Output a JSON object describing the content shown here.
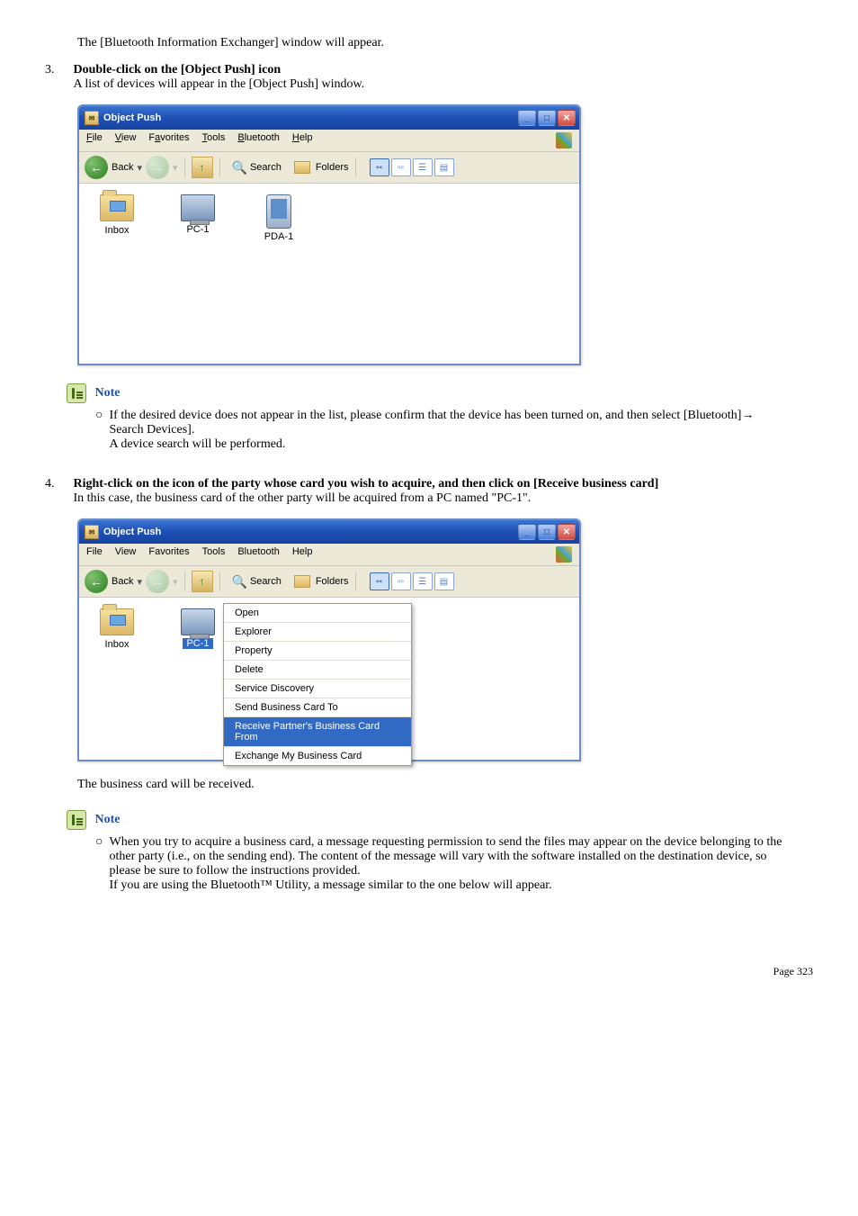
{
  "intro_text": "The [Bluetooth Information Exchanger] window will appear.",
  "step3": {
    "num": "3.",
    "title": "Double-click on the [Object Push] icon",
    "sub": "A list of devices will appear in the [Object Push] window."
  },
  "win1": {
    "title": "Object Push",
    "menus": {
      "file": "File",
      "view": "View",
      "favorites": "Favorites",
      "tools": "Tools",
      "bluetooth": "Bluetooth",
      "help": "Help"
    },
    "toolbar": {
      "back": "Back",
      "search": "Search",
      "folders": "Folders"
    },
    "items": {
      "inbox": "Inbox",
      "pc1": "PC-1",
      "pda1": "PDA-1"
    }
  },
  "note1": {
    "label": "Note",
    "line1": "If the desired device does not appear in the list, please confirm that the device has been turned on, and then select [Bluetooth]→ Search Devices].",
    "line2": "A device search will be performed."
  },
  "step4": {
    "num": "4.",
    "title": "Right-click on the icon of the party whose card you wish to acquire, and then click on [Receive business card]",
    "sub": "In this case, the business card of the other party will be acquired from a PC named \"PC-1\"."
  },
  "win2": {
    "title": "Object Push",
    "menus": {
      "file": "File",
      "view": "View",
      "favorites": "Favorites",
      "tools": "Tools",
      "bluetooth": "Bluetooth",
      "help": "Help"
    },
    "toolbar": {
      "back": "Back",
      "search": "Search",
      "folders": "Folders"
    },
    "items": {
      "inbox": "Inbox",
      "pc1": "PC-1"
    },
    "ctx": {
      "open": "Open",
      "explorer": "Explorer",
      "property": "Property",
      "delete": "Delete",
      "service": "Service Discovery",
      "sendcard": "Send Business Card To",
      "receive": "Receive Partner's Business Card From",
      "exchange": "Exchange My Business Card"
    }
  },
  "received_text": "The business card will be received.",
  "note2": {
    "label": "Note",
    "line1": "When you try to acquire a business card, a message requesting permission to send the files may appear on the device belonging to the other party (i.e., on the sending end). The content of the message will vary with the software installed on the destination device, so please be sure to follow the instructions provided.",
    "line2": "If you are using the Bluetooth™ Utility, a message similar to the one below will appear."
  },
  "footer": "Page 323"
}
